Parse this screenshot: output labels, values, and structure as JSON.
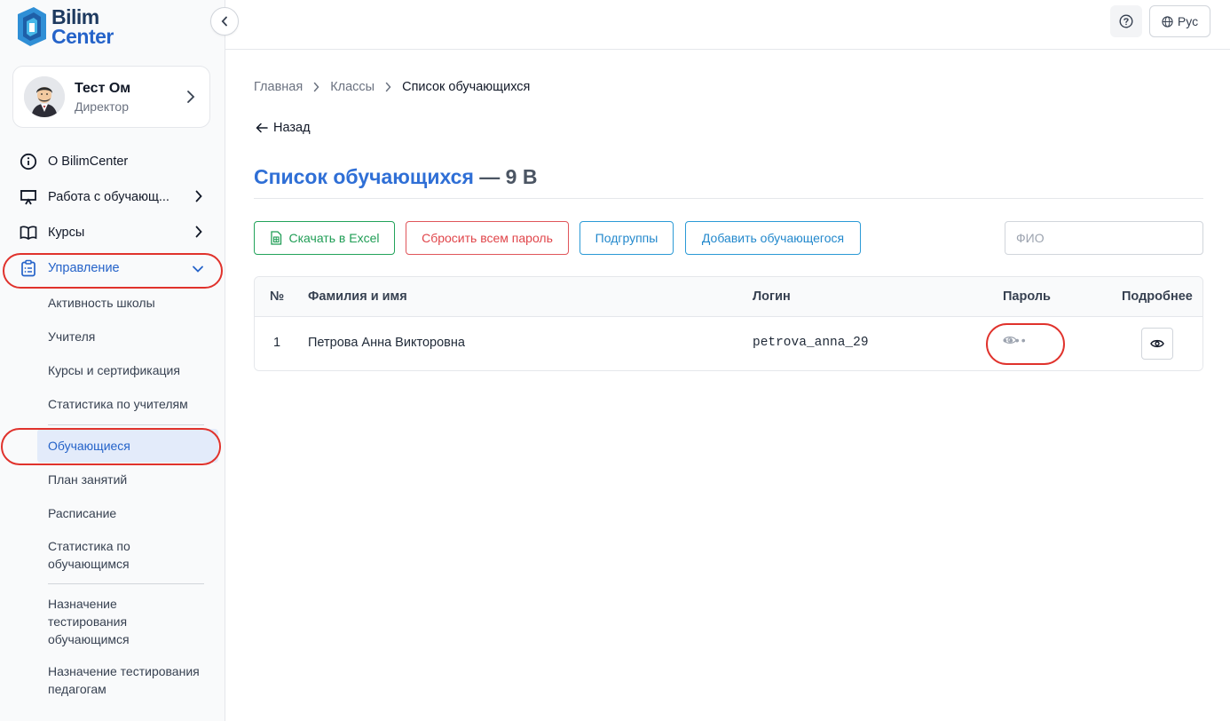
{
  "brand": {
    "line1": "Bilim",
    "line2": "Center",
    "color": "#2563c9"
  },
  "profile": {
    "name": "Тест Ом",
    "role": "Директор"
  },
  "nav": {
    "about": "О BilimCenter",
    "students_work": "Работа с обучающ...",
    "courses": "Курсы",
    "management": "Управление",
    "sub": {
      "school_activity": "Активность школы",
      "teachers": "Учителя",
      "courses_cert": "Курсы и сертификация",
      "teacher_stats": "Статистика по учителям",
      "students": "Обучающиеся",
      "lesson_plan": "План занятий",
      "schedule": "Расписание",
      "student_stats": "Статистика по обучающимся",
      "assign_students": "Назначение тестирования обучающимся",
      "assign_teachers": "Назначение тестирования педагогам"
    }
  },
  "topbar": {
    "language": "Рус"
  },
  "breadcrumb": {
    "home": "Главная",
    "classes": "Классы",
    "current": "Список обучающихся"
  },
  "back_label": "Назад",
  "page": {
    "title": "Список обучающихся",
    "class_suffix": "— 9 В"
  },
  "toolbar": {
    "excel": "Скачать в Excel",
    "reset": "Сбросить всем пароль",
    "subgroups": "Подгруппы",
    "add_student": "Добавить обучающегося",
    "search_placeholder": "ФИО"
  },
  "table": {
    "headers": {
      "num": "№",
      "name": "Фамилия и имя",
      "login": "Логин",
      "password": "Пароль",
      "details": "Подробнее"
    },
    "rows": [
      {
        "num": "1",
        "name": "Петрова Анна Викторовна",
        "login": "petrova_anna_29",
        "password_mask": "••••"
      }
    ]
  },
  "colors": {
    "accent": "#2563c9",
    "danger": "#e0454a",
    "success": "#1f9d55",
    "info": "#2288cc",
    "highlight": "#e0322c"
  }
}
